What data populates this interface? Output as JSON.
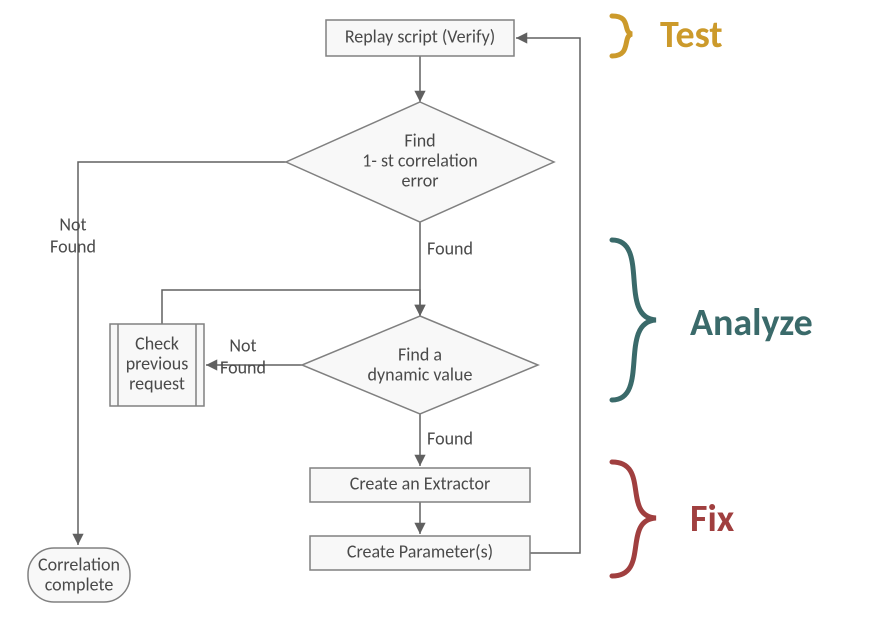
{
  "nodes": {
    "replay": {
      "line1": "Replay script (Verify)"
    },
    "findErr": {
      "line1": "Find",
      "line2": "1- st correlation",
      "line3": "error"
    },
    "findDyn": {
      "line1": "Find a",
      "line2": "dynamic value"
    },
    "checkPrev": {
      "line1": "Check",
      "line2": "previous",
      "line3": "request"
    },
    "extractor": {
      "line1": "Create an Extractor"
    },
    "params": {
      "line1": "Create Parameter(s)"
    },
    "complete": {
      "line1": "Correlation",
      "line2": "complete"
    }
  },
  "edges": {
    "errNotFound1": "Not",
    "errNotFound2": "Found",
    "errFound": "Found",
    "dynNotFound1": "Not",
    "dynNotFound2": "Found",
    "dynFound": "Found"
  },
  "phases": {
    "test": "Test",
    "analyze": "Analyze",
    "fix": "Fix"
  }
}
